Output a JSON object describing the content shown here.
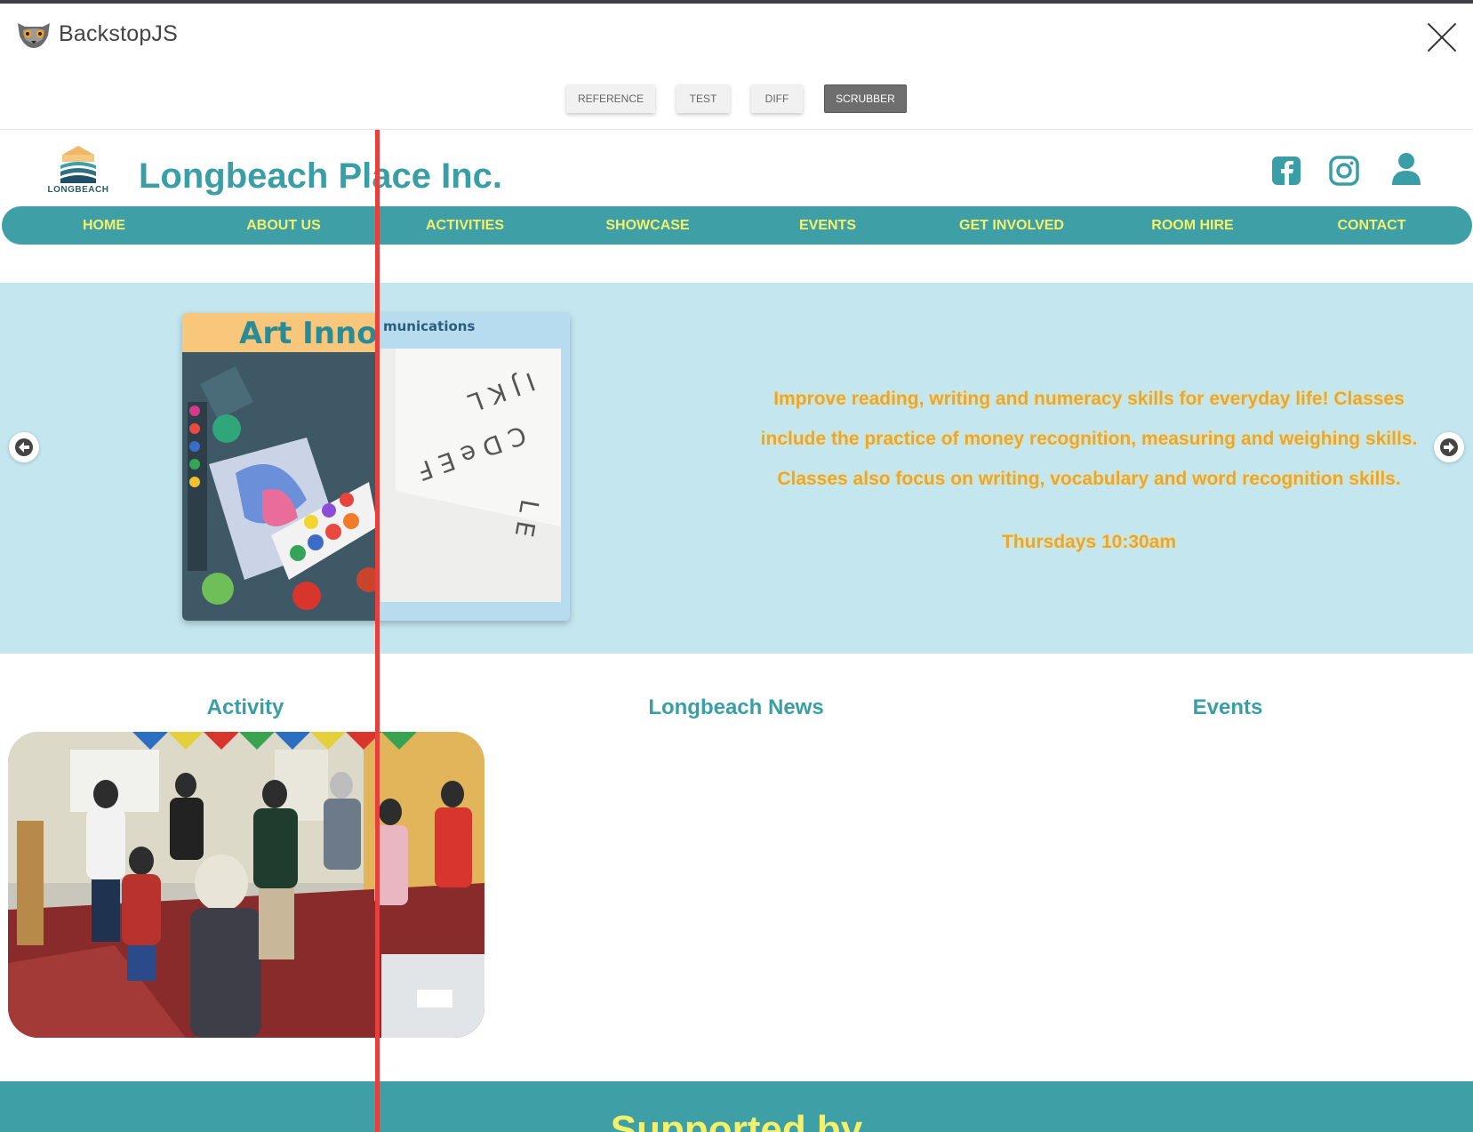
{
  "app": {
    "title": "BackstopJS"
  },
  "tabs": [
    {
      "label": "REFERENCE",
      "active": false
    },
    {
      "label": "TEST",
      "active": false
    },
    {
      "label": "DIFF",
      "active": false
    },
    {
      "label": "SCRUBBER",
      "active": true
    }
  ],
  "site": {
    "logo_text": "LONGBEACH",
    "title": "Longbeach Place Inc.",
    "social": [
      "facebook-icon",
      "instagram-icon",
      "user-icon"
    ],
    "nav": [
      "HOME",
      "ABOUT US",
      "ACTIVITIES",
      "SHOWCASE",
      "EVENTS",
      "GET INVOLVED",
      "ROOM HIRE",
      "CONTACT"
    ],
    "slide": {
      "banner_left": "Art Innov",
      "banner_right": "munications",
      "text": "Improve reading, writing and numeracy skills for everyday life! Classes include the practice of money recognition, measuring and weighing skills. Classes also focus on writing, vocabulary and word recognition skills.",
      "time": "Thursdays 10:30am"
    },
    "columns": [
      "Activity",
      "Longbeach News",
      "Events"
    ],
    "footer_title": "Supported by"
  },
  "colors": {
    "teal": "#3e9fa7",
    "nav_text": "#f4f06a",
    "hero_bg": "#c4e6ef",
    "hero_text": "#e8a53a",
    "scrubber": "#e7403c"
  }
}
